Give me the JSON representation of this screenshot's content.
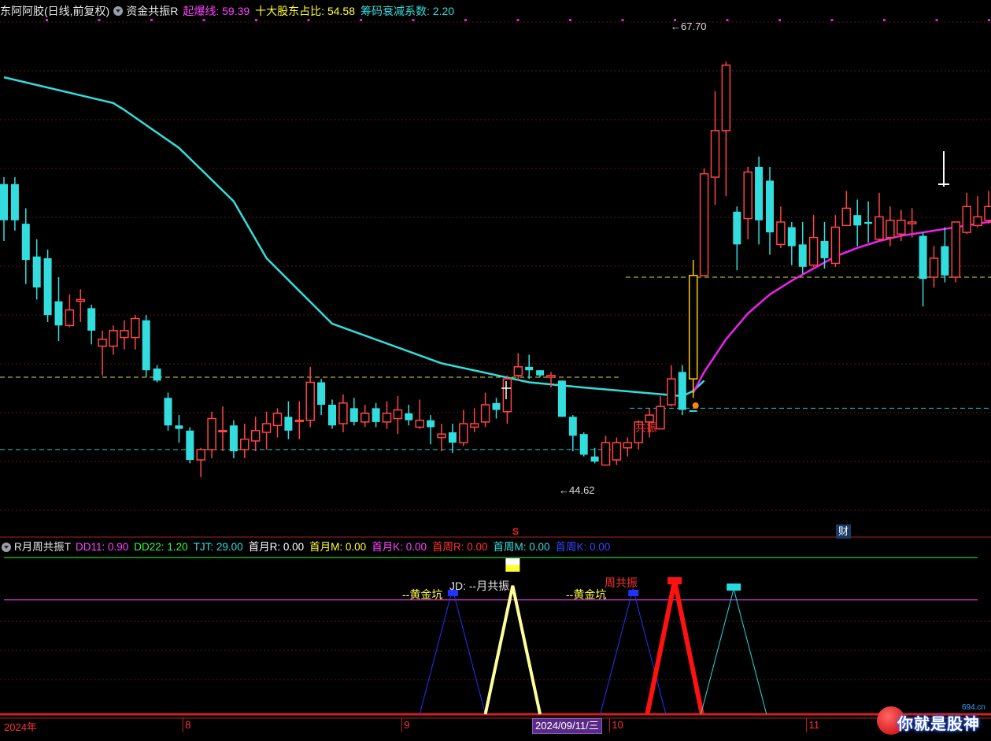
{
  "header": {
    "stock": "东阿阿胶(日线,前复权)",
    "indicator": "资金共振R",
    "params": [
      {
        "label": "起爆线:",
        "value": "59.39",
        "color": "#ff44ff"
      },
      {
        "label": "十大股东占比:",
        "value": "54.58",
        "color": "#ffff33"
      },
      {
        "label": "筹码衰减系数:",
        "value": "2.20",
        "color": "#33dddd"
      }
    ]
  },
  "sub_header": {
    "name": "R月周共振T",
    "params": [
      {
        "label": "DD11:",
        "value": "0.90",
        "color": "#ff44ff"
      },
      {
        "label": "DD22:",
        "value": "1.20",
        "color": "#33ff33"
      },
      {
        "label": "TJT:",
        "value": "29.00",
        "color": "#33dddd"
      },
      {
        "label": "首月R:",
        "value": "0.00",
        "color": "#ffffff"
      },
      {
        "label": "首月M:",
        "value": "0.00",
        "color": "#ffff33"
      },
      {
        "label": "首月K:",
        "value": "0.00",
        "color": "#ff44ff"
      },
      {
        "label": "首周R:",
        "value": "0.00",
        "color": "#ff3333"
      },
      {
        "label": "首周M:",
        "value": "0.00",
        "color": "#33dddd"
      },
      {
        "label": "首周K:",
        "value": "0.00",
        "color": "#3344ff"
      }
    ]
  },
  "annotations": {
    "high": "67.70",
    "low": "44.62",
    "resonance": "共振",
    "s_marker": "S",
    "cai_marker": "财",
    "gold_pit_1": "黄金坑",
    "gold_pit_2": "黄金坑",
    "month_res": "JD: --月共振",
    "week_res": "周共振",
    "date_badge": "2024/09/11/三",
    "watermark": "你就是股神",
    "site": "694.cn"
  },
  "axis": {
    "year": "2024年",
    "months": [
      {
        "label": "8",
        "idx": 17
      },
      {
        "label": "9",
        "idx": 37
      },
      {
        "label": "10",
        "idx": 56
      },
      {
        "label": "11",
        "idx": 74
      }
    ]
  },
  "colors": {
    "up": "#ff4444",
    "down": "#33dddd",
    "ma_long": "#33dddd",
    "ma_short": "#ee22ee",
    "level_yellow": "#dddd33",
    "level_cyan": "#22cccc"
  },
  "chart_data": {
    "type": "candlestick",
    "ylim": [
      42.5,
      70
    ],
    "levels": {
      "upper_yellow": 55.2,
      "mid_yellow": 49.4,
      "cyan_right": 47.6,
      "cyan_left": 45.2
    },
    "candles": [
      [
        60.6,
        58.5,
        61.0,
        57.3
      ],
      [
        60.6,
        58.5,
        61.0,
        57.9
      ],
      [
        58.3,
        56.2,
        59.2,
        54.8
      ],
      [
        56.4,
        54.6,
        57.4,
        53.9
      ],
      [
        56.3,
        53.0,
        56.8,
        52.6
      ],
      [
        53.8,
        52.4,
        55.2,
        51.5
      ],
      [
        52.4,
        53.3,
        54.2,
        52.3
      ],
      [
        53.8,
        53.9,
        54.5,
        52.6
      ],
      [
        53.4,
        52.1,
        53.6,
        51.3
      ],
      [
        51.2,
        51.6,
        52.1,
        49.5
      ],
      [
        51.2,
        52.1,
        52.4,
        50.7
      ],
      [
        51.7,
        52.1,
        52.7,
        51.0
      ],
      [
        51.7,
        52.8,
        53.0,
        51.0
      ],
      [
        52.7,
        49.8,
        53.0,
        49.4
      ],
      [
        49.9,
        49.2,
        50.1,
        49.1
      ],
      [
        48.2,
        46.6,
        48.5,
        46.3
      ],
      [
        46.6,
        46.4,
        47.2,
        45.6
      ],
      [
        46.3,
        44.6,
        46.5,
        44.4
      ],
      [
        44.6,
        45.2,
        45.3,
        43.6
      ],
      [
        45.2,
        47.0,
        47.4,
        44.7
      ],
      [
        46.3,
        46.3,
        47.7,
        45.1
      ],
      [
        46.6,
        45.1,
        46.9,
        44.7
      ],
      [
        45.2,
        45.8,
        46.7,
        44.7
      ],
      [
        45.7,
        46.3,
        47.1,
        45.1
      ],
      [
        46.2,
        46.7,
        47.4,
        45.2
      ],
      [
        46.6,
        47.3,
        47.6,
        45.9
      ],
      [
        47.1,
        46.3,
        48.0,
        45.8
      ],
      [
        46.9,
        46.9,
        48.0,
        45.8
      ],
      [
        46.9,
        49.1,
        50.0,
        46.5
      ],
      [
        49.1,
        47.8,
        49.3,
        47.2
      ],
      [
        47.8,
        46.6,
        48.1,
        46.4
      ],
      [
        46.7,
        47.9,
        48.4,
        46.2
      ],
      [
        47.6,
        46.8,
        48.2,
        46.6
      ],
      [
        46.8,
        47.3,
        47.8,
        46.5
      ],
      [
        47.6,
        46.8,
        47.9,
        46.5
      ],
      [
        46.8,
        47.3,
        48.0,
        46.4
      ],
      [
        47.0,
        47.5,
        48.3,
        46.1
      ],
      [
        47.3,
        46.9,
        47.8,
        46.6
      ],
      [
        46.5,
        46.9,
        48.1,
        46.4
      ],
      [
        46.9,
        46.5,
        47.2,
        45.5
      ],
      [
        45.9,
        46.1,
        46.7,
        45.1
      ],
      [
        46.2,
        45.6,
        46.7,
        45.0
      ],
      [
        45.6,
        46.7,
        47.5,
        45.4
      ],
      [
        46.5,
        46.7,
        47.6,
        46.2
      ],
      [
        46.8,
        47.8,
        48.5,
        46.5
      ],
      [
        47.9,
        47.5,
        48.2,
        47.0
      ],
      [
        47.4,
        49.3,
        49.5,
        46.7
      ],
      [
        49.5,
        50.0,
        50.8,
        49.2
      ],
      [
        50.0,
        49.8,
        50.7,
        49.3
      ],
      [
        49.8,
        49.5,
        49.8,
        49.4
      ],
      [
        49.4,
        49.5,
        49.7,
        48.8
      ],
      [
        49.2,
        47.1,
        49.2,
        47.1
      ],
      [
        47.1,
        46.0,
        47.2,
        45.1
      ],
      [
        46.1,
        44.9,
        46.2,
        44.8
      ],
      [
        44.8,
        44.5,
        45.3,
        44.4
      ],
      [
        44.3,
        45.6,
        46.0,
        44.3
      ],
      [
        44.6,
        45.6,
        45.9,
        44.3
      ],
      [
        45.3,
        45.6,
        45.9,
        44.8
      ],
      [
        45.6,
        46.8,
        46.9,
        45.2
      ],
      [
        46.8,
        47.2,
        47.6,
        45.9
      ],
      [
        46.4,
        47.7,
        48.3,
        46.4
      ],
      [
        47.8,
        49.3,
        50.1,
        47.7
      ],
      [
        49.7,
        47.5,
        50.1,
        47.2
      ],
      [
        49.3,
        55.3,
        56.2,
        48.2
      ],
      [
        55.3,
        61.2,
        61.5,
        55.3
      ],
      [
        61.0,
        63.7,
        66.0,
        59.4
      ],
      [
        63.7,
        67.5,
        67.7,
        59.9
      ],
      [
        59.0,
        57.1,
        59.3,
        55.6
      ],
      [
        58.6,
        61.3,
        61.6,
        57.4
      ],
      [
        61.6,
        58.5,
        62.2,
        57.1
      ],
      [
        60.8,
        57.8,
        61.6,
        56.5
      ],
      [
        57.1,
        58.4,
        59.3,
        56.9
      ],
      [
        58.1,
        57.0,
        58.4,
        55.9
      ],
      [
        57.1,
        55.8,
        58.4,
        55.4
      ],
      [
        55.9,
        57.5,
        58.8,
        55.8
      ],
      [
        57.3,
        56.3,
        58.4,
        55.7
      ],
      [
        56.0,
        58.1,
        58.8,
        55.8
      ],
      [
        58.2,
        59.2,
        60.2,
        58.2
      ],
      [
        58.8,
        58.2,
        59.7,
        57.0
      ],
      [
        58.4,
        58.3,
        59.6,
        57.2
      ],
      [
        57.4,
        58.7,
        60.1,
        57.3
      ],
      [
        57.5,
        58.5,
        59.3,
        57.0
      ],
      [
        57.7,
        58.5,
        59.1,
        57.3
      ],
      [
        58.3,
        58.4,
        59.2,
        57.5
      ],
      [
        57.6,
        55.1,
        57.8,
        53.5
      ],
      [
        55.2,
        56.3,
        57.0,
        54.6
      ],
      [
        57.0,
        55.3,
        58.1,
        54.9
      ],
      [
        55.2,
        58.4,
        58.4,
        54.9
      ],
      [
        57.8,
        59.3,
        60.1,
        57.7
      ],
      [
        58.2,
        58.7,
        59.9,
        58.1
      ],
      [
        58.5,
        59.3,
        60.2,
        58.3
      ],
      [
        58.4,
        58.4,
        60.0,
        58.3
      ],
      [
        58.6,
        58.4,
        58.9,
        58.1
      ],
      [
        58.4,
        57.8,
        58.7,
        57.2
      ],
      [
        58.1,
        56.5,
        58.4,
        56.3
      ]
    ],
    "ma_long": [
      [
        0,
        66.8
      ],
      [
        8,
        65.6
      ],
      [
        10,
        65.3
      ],
      [
        11,
        64.9
      ],
      [
        16,
        62.7
      ],
      [
        21,
        59.6
      ],
      [
        24,
        56.3
      ],
      [
        30,
        52.5
      ],
      [
        40,
        50.2
      ],
      [
        48,
        49.1
      ],
      [
        53,
        48.8
      ],
      [
        62,
        48.3
      ],
      [
        63,
        48.6
      ],
      [
        64,
        49.2
      ]
    ],
    "ma_short": [
      [
        63,
        48.5
      ],
      [
        64,
        49.7
      ],
      [
        66,
        51.6
      ],
      [
        68,
        53.1
      ],
      [
        70,
        54.2
      ],
      [
        72,
        55.0
      ],
      [
        74,
        55.7
      ],
      [
        76,
        56.4
      ],
      [
        78,
        56.9
      ],
      [
        80,
        57.3
      ],
      [
        82,
        57.6
      ],
      [
        84,
        57.8
      ],
      [
        86,
        58.0
      ],
      [
        88,
        58.2
      ],
      [
        90,
        58.4
      ],
      [
        92,
        58.5
      ],
      [
        95,
        58.7
      ]
    ],
    "lower_panel": {
      "ylim": [
        0,
        100
      ],
      "hline_green": 100,
      "hline_magenta": 73,
      "peaks": [
        {
          "center": 41,
          "half_width": 3,
          "height": 80,
          "color": "#2233ff",
          "width": 1
        },
        {
          "center": 46.5,
          "half_width": 2.5,
          "height": 82,
          "color": "#ffff99",
          "width": 4
        },
        {
          "center": 57.5,
          "half_width": 3,
          "height": 80,
          "color": "#2233ff",
          "width": 1
        },
        {
          "center": 61.3,
          "half_width": 2.5,
          "height": 85,
          "color": "#ff1111",
          "width": 6
        },
        {
          "center": 66.7,
          "half_width": 3,
          "height": 80,
          "color": "#22dddd",
          "width": 1
        }
      ]
    }
  }
}
